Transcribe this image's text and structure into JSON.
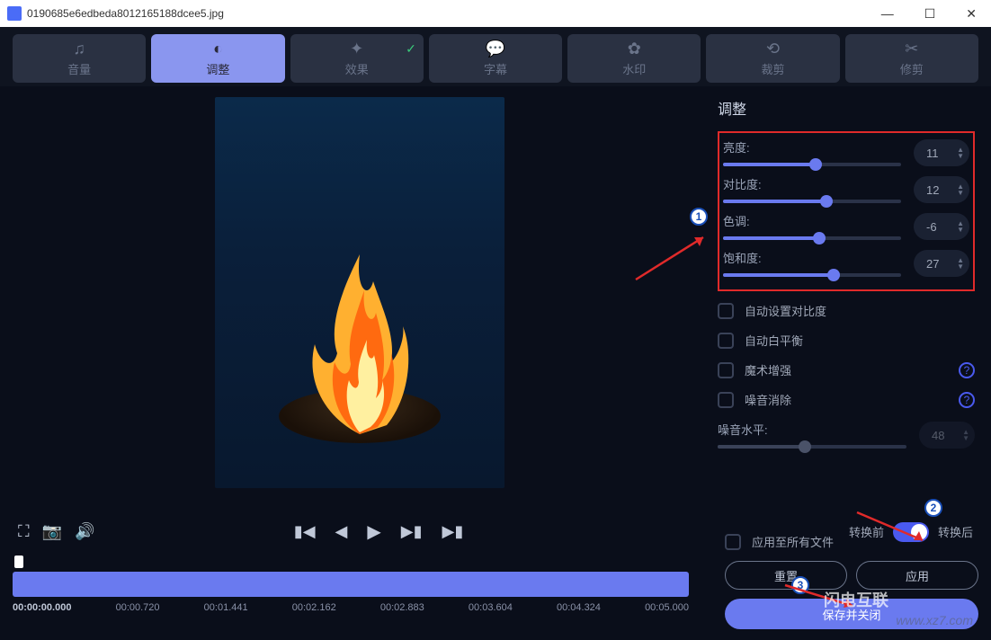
{
  "titlebar": {
    "filename": "0190685e6edbeda8012165188dcee5.jpg"
  },
  "tabs": {
    "volume": "音量",
    "adjust": "调整",
    "effect": "效果",
    "subtitle": "字幕",
    "watermark": "水印",
    "crop": "裁剪",
    "trim": "修剪"
  },
  "panel": {
    "title": "调整",
    "brightness": {
      "label": "亮度:",
      "value": "11",
      "percent": 52
    },
    "contrast": {
      "label": "对比度:",
      "value": "12",
      "percent": 58
    },
    "hue": {
      "label": "色调:",
      "value": "-6",
      "percent": 54
    },
    "saturation": {
      "label": "饱和度:",
      "value": "27",
      "percent": 62
    },
    "noise_level": {
      "label": "噪音水平:",
      "value": "48",
      "percent": 46
    },
    "auto_contrast": "自动设置对比度",
    "auto_wb": "自动白平衡",
    "magic_enhance": "魔术增强",
    "denoise": "噪音消除"
  },
  "toggle": {
    "before": "转换前",
    "after": "转换后"
  },
  "timeline": {
    "start": "00:00:00.000",
    "t1": "00:00.720",
    "t2": "00:01.441",
    "t3": "00:02.162",
    "t4": "00:02.883",
    "t5": "00:03.604",
    "t6": "00:04.324",
    "t7": "00:05.000"
  },
  "bottom": {
    "apply_all": "应用至所有文件",
    "reset": "重置",
    "apply": "应用",
    "save_close": "保存并关闭"
  },
  "annotations": {
    "n1": "1",
    "n2": "2",
    "n3": "3"
  },
  "watermark": {
    "url": "www.xz7.com",
    "brand": "闪电互联"
  }
}
